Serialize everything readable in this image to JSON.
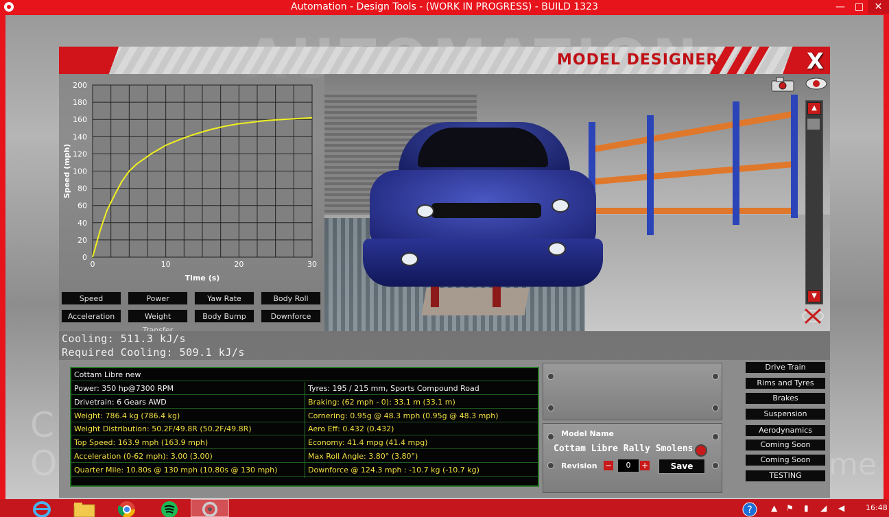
{
  "window": {
    "title": "Automation - Design Tools - (WORK IN PROGRESS) - BUILD 1323",
    "min_label": "—",
    "max_label": "□",
    "close_label": "✕"
  },
  "background": {
    "logo_text": "AUTOMATION",
    "left_text_1": "C",
    "left_text_2": "O",
    "right_text": "me"
  },
  "header": {
    "title": "MODEL DESIGNER",
    "close_label": "X"
  },
  "chart_data": {
    "type": "line",
    "xlabel": "Time (s)",
    "ylabel": "Speed (mph)",
    "xlim": [
      0,
      30
    ],
    "ylim": [
      0,
      200
    ],
    "x_ticks": [
      "0",
      "10",
      "20",
      "30"
    ],
    "y_ticks": [
      "0",
      "20",
      "40",
      "60",
      "80",
      "100",
      "120",
      "140",
      "160",
      "180",
      "200"
    ],
    "grid": true,
    "series": [
      {
        "color": "#f0f020",
        "x": [
          0,
          0.5,
          1,
          1.5,
          2,
          3,
          4,
          5,
          6,
          8,
          10,
          12,
          14,
          16,
          18,
          20,
          22,
          24,
          26,
          28,
          30
        ],
        "y": [
          0,
          15,
          30,
          43,
          55,
          72,
          88,
          100,
          108,
          120,
          130,
          137,
          143,
          148,
          152,
          155,
          157,
          159,
          160,
          161,
          162
        ]
      }
    ]
  },
  "chart_buttons": [
    "Speed",
    "Power",
    "Yaw Rate",
    "Body Roll",
    "Acceleration",
    "Weight Transfer",
    "Body Bump",
    "Downforce"
  ],
  "cooling": {
    "cooling": "Cooling: 511.3 kJ/s",
    "required": "Required Cooling: 509.1 kJ/s"
  },
  "stats": {
    "model": "Cottam Libre new",
    "left": [
      {
        "text": "Power: 350 hp@7300 RPM",
        "color": "white"
      },
      {
        "text": "Drivetrain: 6 Gears AWD",
        "color": "white"
      },
      {
        "text": "Weight: 786.4 kg (786.4 kg)",
        "color": "yellow"
      },
      {
        "text": "Weight Distribution: 50.2F/49.8R (50.2F/49.8R)",
        "color": "yellow"
      },
      {
        "text": "Top Speed: 163.9 mph (163.9 mph)",
        "color": "yellow"
      },
      {
        "text": "Acceleration (0-62 mph): 3.00 (3.00)",
        "color": "yellow"
      },
      {
        "text": "Quarter Mile: 10.80s @ 130 mph (10.80s @ 130 mph)",
        "color": "yellow"
      }
    ],
    "right": [
      {
        "text": "Tyres: 195 / 215 mm, Sports Compound Road",
        "color": "white"
      },
      {
        "text": "Braking: (62 mph - 0): 33.1 m (33.1 m)",
        "color": "yellow"
      },
      {
        "text": "Cornering: 0.95g @ 48.3 mph (0.95g @ 48.3 mph)",
        "color": "yellow"
      },
      {
        "text": "Aero Eff: 0.432 (0.432)",
        "color": "yellow"
      },
      {
        "text": "Economy: 41.4 mpg (41.4 mpg)",
        "color": "yellow"
      },
      {
        "text": "Max Roll Angle: 3.80° (3.80°)",
        "color": "yellow"
      },
      {
        "text": "Downforce @ 124.3 mph : -10.7 kg (-10.7 kg)",
        "color": "yellow"
      }
    ]
  },
  "model_panel": {
    "name_label": "Model Name",
    "name_value": "Cottam Libre Rally Smolensk",
    "revision_label": "Revision",
    "revision_value": "0",
    "minus_label": "−",
    "plus_label": "+",
    "save_label": "Save"
  },
  "nav": [
    "Drive Train",
    "Rims and Tyres",
    "Brakes",
    "Suspension",
    "Aerodynamics",
    "Coming Soon",
    "Coming Soon",
    "TESTING"
  ],
  "taskbar": {
    "clock": "16:48"
  },
  "colors": {
    "window_red": "#e8141b",
    "chart_line": "#f0f020",
    "stat_yellow": "#f0e040",
    "stat_border": "#2a7a2a"
  }
}
